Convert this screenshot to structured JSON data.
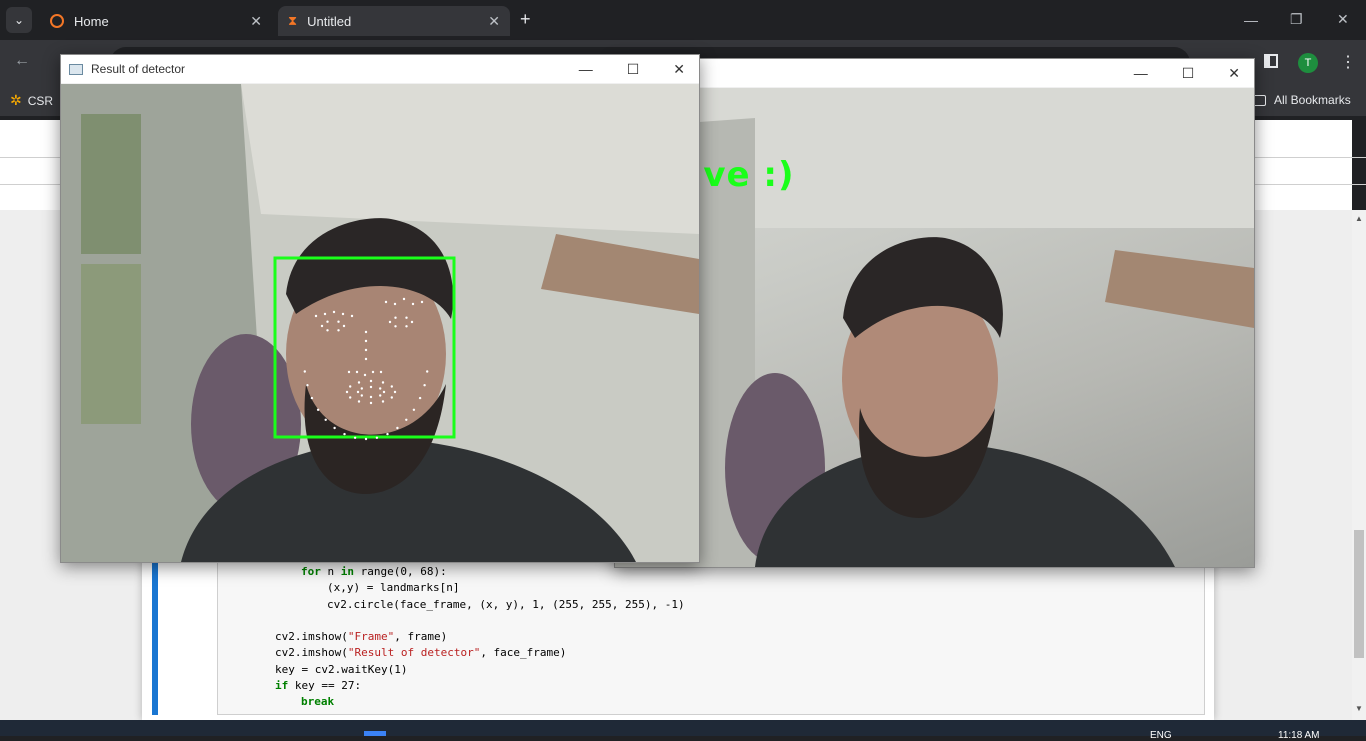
{
  "browser": {
    "tabs": [
      {
        "label": "Home",
        "active": false
      },
      {
        "label": "Untitled",
        "active": true
      }
    ],
    "new_tab": "+",
    "bookmarks": [
      {
        "label": "CSR"
      }
    ],
    "all_bookmarks": "All Bookmarks",
    "profile_initial": "T"
  },
  "windows": {
    "detector": {
      "title": "Result of detector",
      "landmark_count": 68
    },
    "frame": {
      "overlay_text": "Active :)"
    }
  },
  "code_lines": [
    {
      "indent": 2,
      "parts": [
        {
          "t": "for",
          "c": "kw"
        },
        {
          "t": " n "
        },
        {
          "t": "in",
          "c": "kw"
        },
        {
          "t": " range(0, 68):"
        }
      ]
    },
    {
      "indent": 3,
      "parts": [
        {
          "t": "(x,y) = landmarks[n]"
        }
      ]
    },
    {
      "indent": 3,
      "parts": [
        {
          "t": "cv2.circle(face_frame, (x, y), 1, (255, 255, 255), -1)"
        }
      ]
    },
    {
      "indent": 0,
      "parts": [
        {
          "t": ""
        }
      ]
    },
    {
      "indent": 1,
      "parts": [
        {
          "t": "cv2.imshow("
        },
        {
          "t": "\"Frame\"",
          "c": "str"
        },
        {
          "t": ", frame)"
        }
      ]
    },
    {
      "indent": 1,
      "parts": [
        {
          "t": "cv2.imshow("
        },
        {
          "t": "\"Result of detector\"",
          "c": "str"
        },
        {
          "t": ", face_frame)"
        }
      ]
    },
    {
      "indent": 1,
      "parts": [
        {
          "t": "key = cv2.waitKey(1)"
        }
      ]
    },
    {
      "indent": 1,
      "parts": [
        {
          "t": "if",
          "c": "kw"
        },
        {
          "t": " key == 27:"
        }
      ]
    },
    {
      "indent": 2,
      "parts": [
        {
          "t": "break",
          "c": "kw"
        }
      ]
    }
  ],
  "taskbar": {
    "lang": "ENG",
    "time": "11:18 AM"
  },
  "colors": {
    "accent_green": "#1aff1a",
    "cell_bar": "#1976d2"
  }
}
